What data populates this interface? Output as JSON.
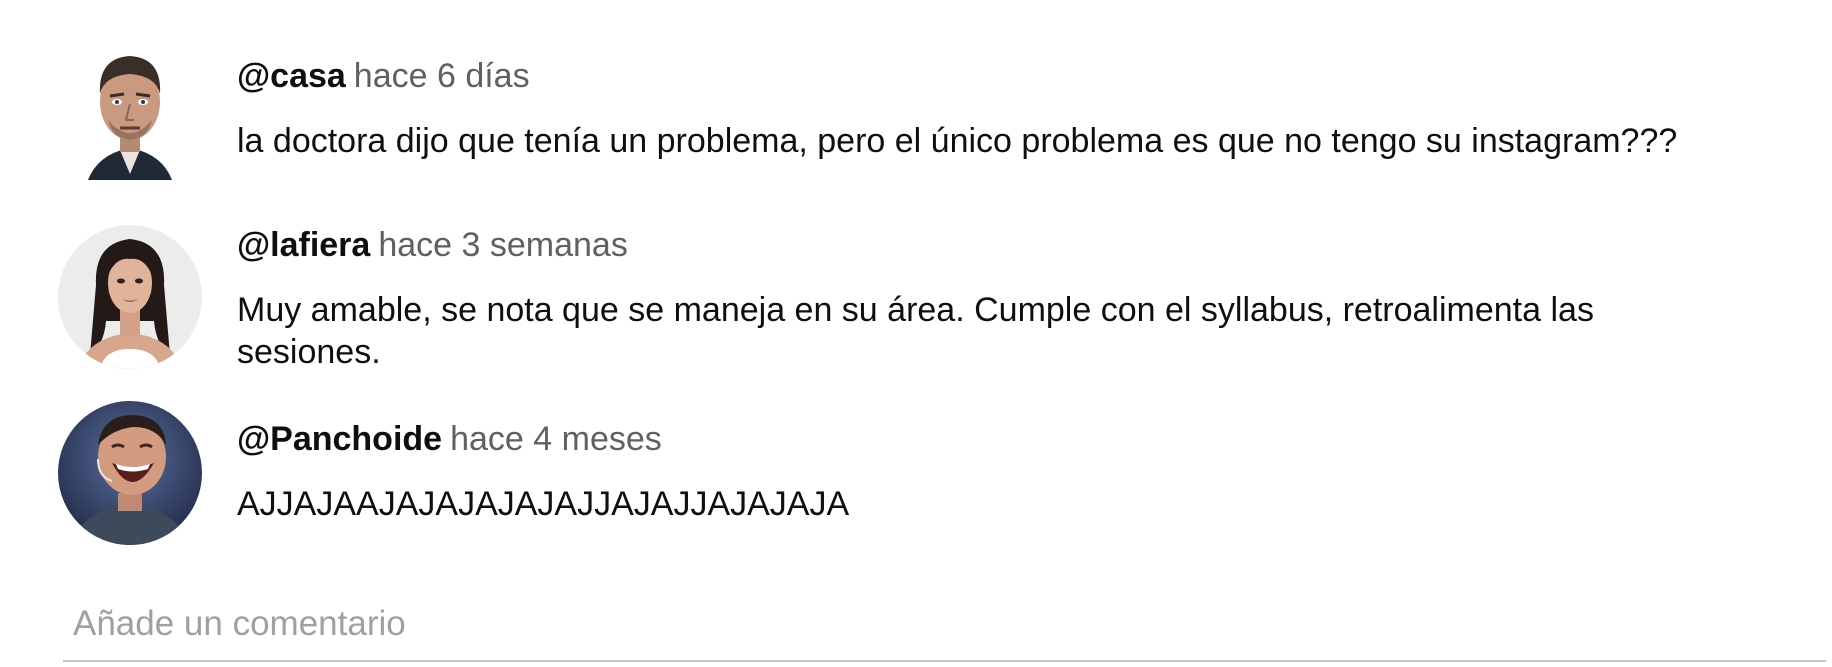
{
  "comments": [
    {
      "author": "@casa",
      "time": "hace 6 días",
      "text": "la doctora dijo que tenía un problema, pero el único problema es que no tengo su instagram???",
      "avatar_icon": "man-portrait-avatar"
    },
    {
      "author": "@lafiera",
      "time": "hace 3 semanas",
      "text": "Muy amable, se nota que se maneja en su área. Cumple con el syllabus, retroalimenta las sesiones.",
      "avatar_icon": "woman-portrait-avatar"
    },
    {
      "author": "@Panchoide",
      "time": "hace 4 meses",
      "text": "AJJAJAAJAJAJAJAJAJJAJAJJAJAJAJA",
      "avatar_icon": "laughing-man-avatar"
    }
  ],
  "composer": {
    "placeholder": "Añade un comentario"
  },
  "colors": {
    "author": "#0f0f0f",
    "timestamp": "#606060",
    "placeholder": "#a0a0a0",
    "underline": "#c6c6c6"
  }
}
